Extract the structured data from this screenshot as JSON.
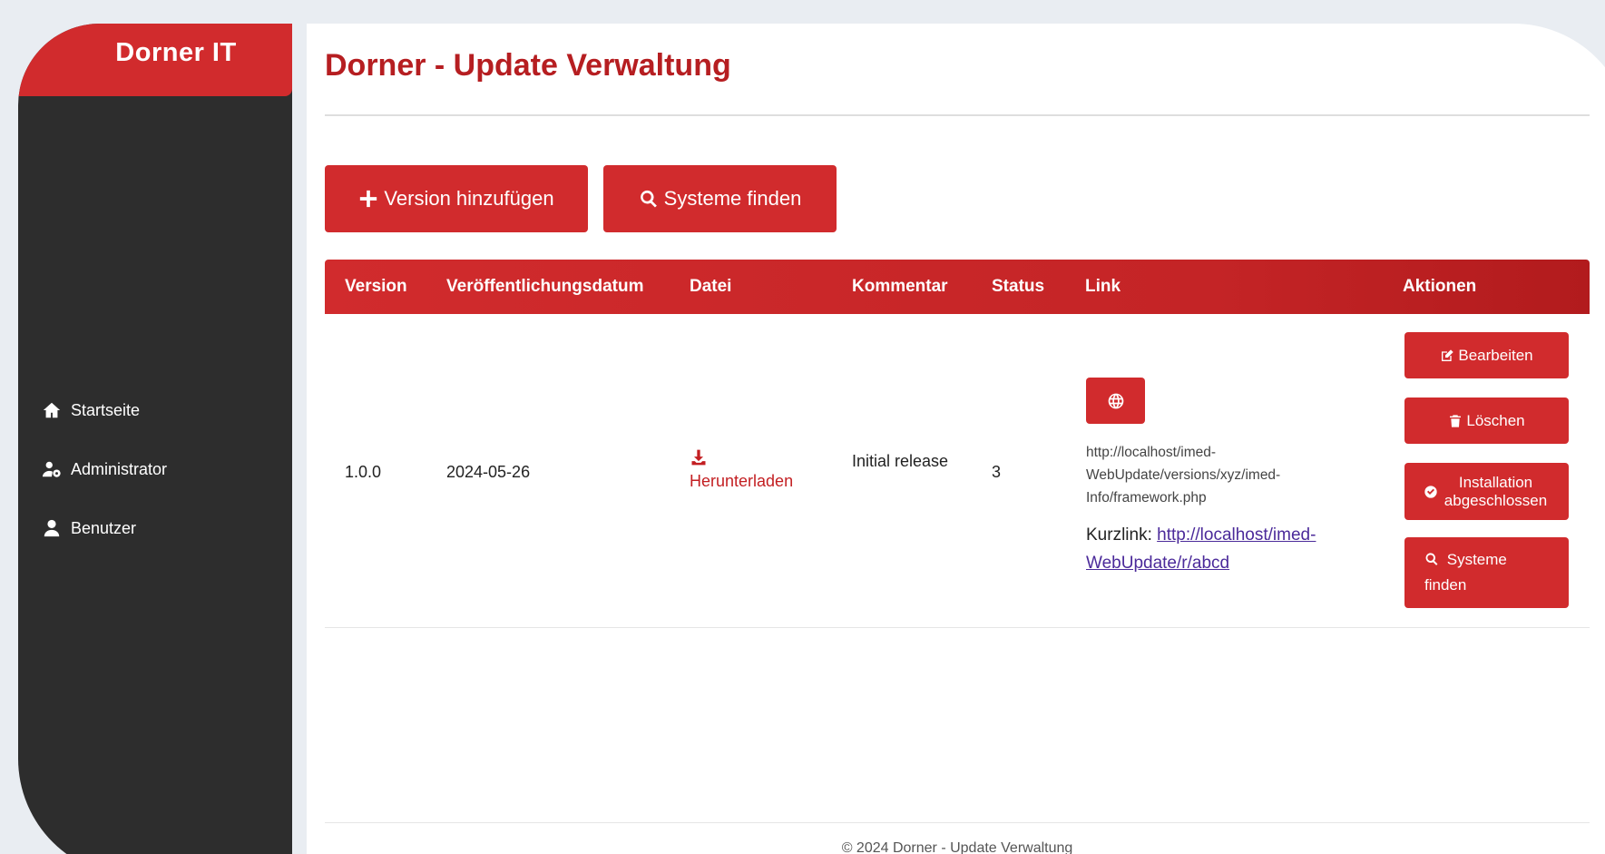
{
  "brand": "Dorner IT",
  "nav": [
    {
      "label": "Startseite",
      "icon": "home-icon"
    },
    {
      "label": "Administrator",
      "icon": "user-gear-icon"
    },
    {
      "label": "Benutzer",
      "icon": "user-icon"
    }
  ],
  "title": "Dorner - Update Verwaltung",
  "toolbar": {
    "add_label": "Version hinzufügen",
    "find_label": "Systeme finden"
  },
  "table": {
    "headers": [
      "Version",
      "Veröffentlichungsdatum",
      "Datei",
      "Kommentar",
      "Status",
      "Link",
      "Aktionen"
    ],
    "row": {
      "version": "1.0.0",
      "date": "2024-05-26",
      "file_link": "Herunterladen",
      "comment": "Initial release",
      "status": "3",
      "url": "http://localhost/imed-WebUpdate/versions/xyz/imed-Info/framework.php",
      "shortlink_label": "Kurzlink:",
      "shortlink": "http://localhost/imed-WebUpdate/r/abcd",
      "actions": {
        "edit": "Bearbeiten",
        "delete": "Löschen",
        "install": "Installation abgeschlossen",
        "find": "Systeme finden"
      }
    }
  },
  "footer": "© 2024 Dorner - Update Verwaltung",
  "colors": {
    "accent": "#d12b2d",
    "sidebar": "#2d2d2d",
    "title": "#b61e21"
  }
}
